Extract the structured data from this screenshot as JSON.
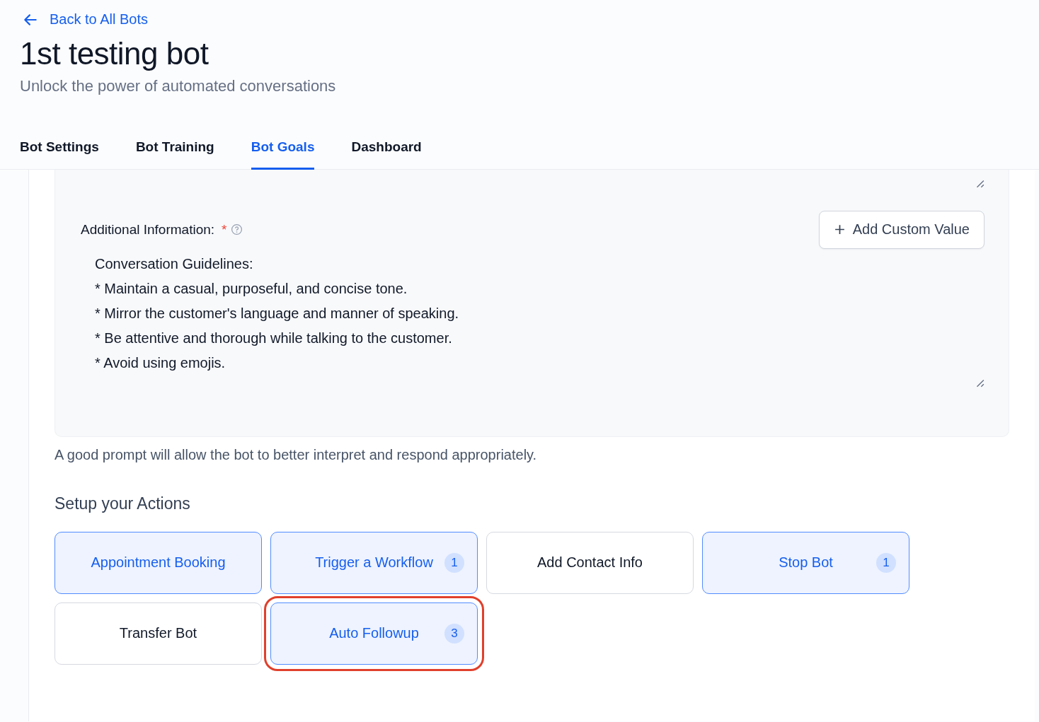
{
  "back_link": {
    "label": "Back to All Bots"
  },
  "title": "1st testing bot",
  "subtitle": "Unlock the power of automated conversations",
  "tabs": [
    {
      "label": "Bot Settings",
      "selected": false
    },
    {
      "label": "Bot Training",
      "selected": false
    },
    {
      "label": "Bot Goals",
      "selected": true
    },
    {
      "label": "Dashboard",
      "selected": false
    }
  ],
  "additional_information": {
    "label": "Additional Information:",
    "required_mark": "*",
    "button": "Add Custom Value",
    "lines": [
      "Conversation Guidelines:",
      "* Maintain a casual, purposeful, and concise tone.",
      "* Mirror the customer's language and manner of speaking.",
      "* Be attentive and thorough while talking to the customer.",
      "* Avoid using emojis."
    ]
  },
  "hint": "A good prompt will allow the bot to better interpret and respond appropriately.",
  "actions_heading": "Setup your Actions",
  "actions": [
    {
      "label": "Appointment Booking",
      "selected": true,
      "highlighted": false
    },
    {
      "label": "Trigger a Workflow",
      "selected": true,
      "count": "1",
      "highlighted": false
    },
    {
      "label": "Add Contact Info",
      "selected": false,
      "highlighted": false
    },
    {
      "label": "Stop Bot",
      "selected": true,
      "count": "1",
      "highlighted": false
    },
    {
      "label": "Transfer Bot",
      "selected": false,
      "highlighted": false
    },
    {
      "label": "Auto Followup",
      "selected": true,
      "count": "3",
      "highlighted": true
    }
  ]
}
